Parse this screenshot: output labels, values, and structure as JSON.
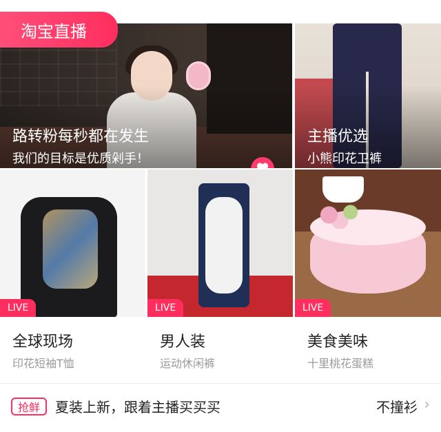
{
  "top_tag": {
    "label": "淘宝直播"
  },
  "hero": {
    "title": "路转粉每秒都在发生",
    "subtitle": "我们的目标是优质剁手！"
  },
  "top_right": {
    "title": "主播优选",
    "subtitle": "小熊印花卫裤"
  },
  "live_badge": "LIVE",
  "items": [
    {
      "title": "全球现场",
      "subtitle": "印花短袖T恤"
    },
    {
      "title": "男人装",
      "subtitle": "运动休闲裤"
    },
    {
      "title": "美食美味",
      "subtitle": "十里桃花蛋糕"
    }
  ],
  "bottom_bar": {
    "badge": "抢鲜",
    "text": "夏装上新，跟着主播买买买",
    "right_text": "不撞衫"
  },
  "icons": {
    "heart": "heart-icon",
    "chevron": "chevron-right-icon"
  },
  "colors": {
    "accent": "#ff2e5e"
  }
}
